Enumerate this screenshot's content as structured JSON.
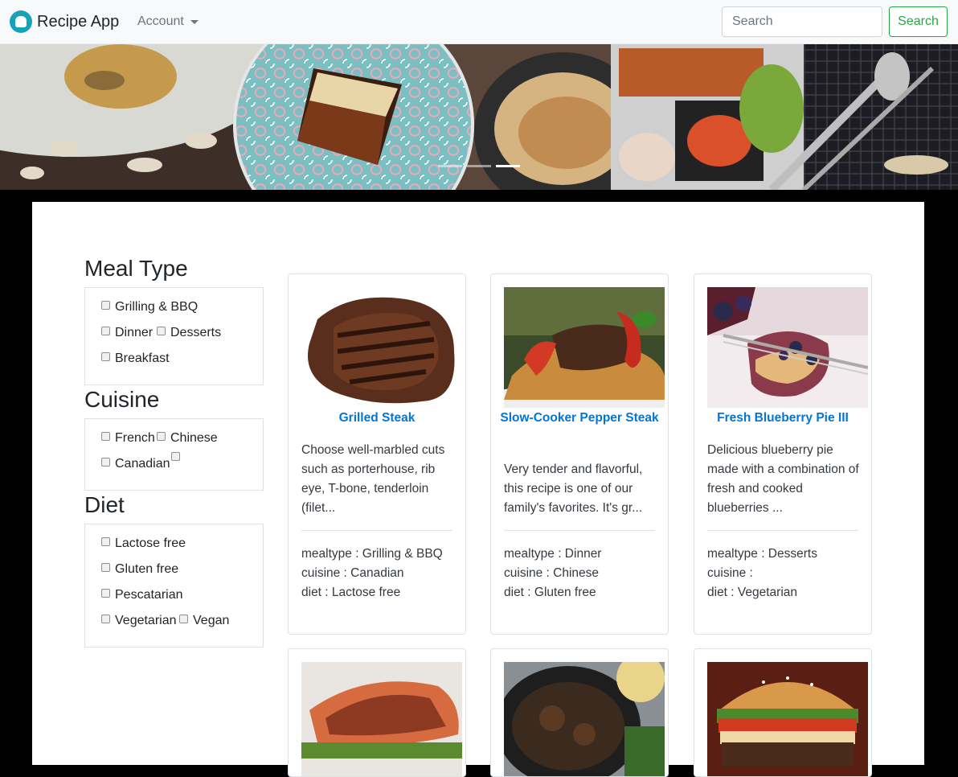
{
  "navbar": {
    "brand": "Recipe App",
    "account_label": "Account",
    "search_placeholder": "Search",
    "search_button": "Search"
  },
  "carousel": {
    "slide_count": 3,
    "active_slide": 3
  },
  "filters": {
    "meal_type": {
      "title": "Meal Type",
      "options": [
        "Grilling & BBQ",
        "Dinner",
        "Desserts",
        "Breakfast"
      ]
    },
    "cuisine": {
      "title": "Cuisine",
      "options": [
        "French",
        "Chinese",
        "Canadian",
        ""
      ]
    },
    "diet": {
      "title": "Diet",
      "options": [
        "Lactose free",
        "Gluten free",
        "Pescatarian",
        "Vegetarian",
        "Vegan"
      ]
    }
  },
  "recipes": [
    {
      "title": "Grilled Steak",
      "description": "Choose well-marbled cuts such as porterhouse, rib eye, T-bone, tenderloin (filet...",
      "mealtype": "mealtype : Grilling & BBQ",
      "cuisine": "cuisine : Canadian",
      "diet": "diet : Lactose free"
    },
    {
      "title": "Slow-Cooker Pepper Steak",
      "description": "Very tender and flavorful, this recipe is one of our family's favorites. It's gr...",
      "mealtype": "mealtype : Dinner",
      "cuisine": "cuisine : Chinese",
      "diet": "diet : Gluten free"
    },
    {
      "title": "Fresh Blueberry Pie III",
      "description": "Delicious blueberry pie made with a combination of fresh and cooked blueberries ...",
      "mealtype": "mealtype : Desserts",
      "cuisine": "cuisine :",
      "diet": "diet : Vegetarian"
    }
  ],
  "colors": {
    "brand_teal": "#17a2b8",
    "link_blue": "#0275d8",
    "success_green": "#28a745"
  }
}
